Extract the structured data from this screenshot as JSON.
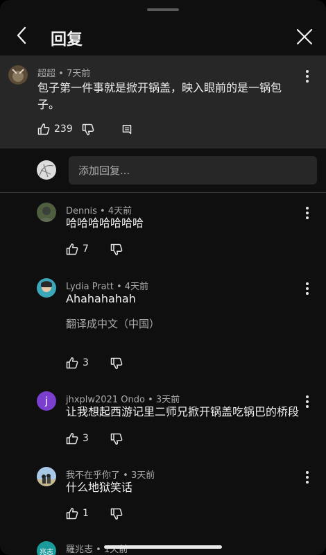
{
  "header": {
    "title": "回复"
  },
  "parent_comment": {
    "author": "超超",
    "time": "7天前",
    "text_line1": "包子第一件事就是掀开锅盖，映入眼前的是一锅包",
    "text_line2": "子。",
    "likes": "239"
  },
  "reply_box": {
    "placeholder": "添加回复..."
  },
  "replies": [
    {
      "author": "Dennis",
      "time": "4天前",
      "text": "哈哈哈哈哈哈哈",
      "likes": "7"
    },
    {
      "author": "Lydia Pratt",
      "time": "4天前",
      "text": "Ahahahahah",
      "translate": "翻译成中文（中国）",
      "likes": "3"
    },
    {
      "author": "jhxplw2021 Ondo",
      "time": "3天前",
      "text": "让我想起西游记里二师兄掀开锅盖吃锅巴的桥段",
      "likes": "3",
      "avatar_letter": "j"
    },
    {
      "author": "我不在乎你了",
      "time": "3天前",
      "text": "什么地狱笑话",
      "likes": "1"
    },
    {
      "author": "羅兆志",
      "time": "1天前",
      "avatar_text": "兆志"
    }
  ],
  "colors": {
    "background": "#0f0f0f",
    "parent_bg": "#272727",
    "meta": "#aaaaaa",
    "purple_avatar": "#7b3fd0",
    "teal_avatar": "#1a9a9a"
  }
}
